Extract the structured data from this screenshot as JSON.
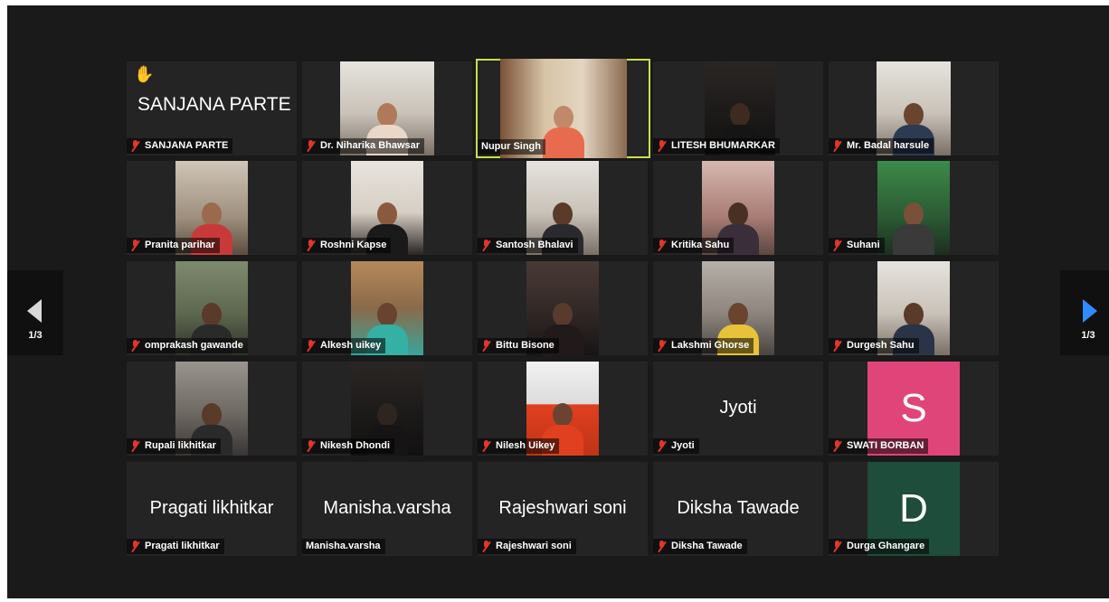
{
  "pager_left": {
    "label": "1/3",
    "icon": "chevron-left-icon"
  },
  "pager_right": {
    "label": "1/3",
    "icon": "chevron-right-icon",
    "color": "#2d8cff"
  },
  "active_speaker_border": "#c8e04a",
  "muted_icon": "mic-muted-icon",
  "participants": [
    {
      "name": "SANJANA PARTE",
      "display_name": "SANJANA PARTE",
      "hand_raised": true,
      "muted": true,
      "video": false
    },
    {
      "name": "Dr. Niharika Bhawsar",
      "muted": true,
      "video": true
    },
    {
      "name": "Nupur Singh",
      "muted": false,
      "video": true,
      "active_speaker": true
    },
    {
      "name": "LITESH BHUMARKAR",
      "muted": true,
      "video": true
    },
    {
      "name": "Mr. Badal harsule",
      "muted": true,
      "video": true
    },
    {
      "name": "Pranita parihar",
      "muted": true,
      "video": true
    },
    {
      "name": "Roshni Kapse",
      "muted": true,
      "video": true
    },
    {
      "name": "Santosh Bhalavi",
      "muted": true,
      "video": true
    },
    {
      "name": "Kritika Sahu",
      "muted": true,
      "video": true
    },
    {
      "name": "Suhani",
      "muted": true,
      "video": true
    },
    {
      "name": "omprakash gawande",
      "muted": true,
      "video": true
    },
    {
      "name": "Alkesh uikey",
      "muted": true,
      "video": true
    },
    {
      "name": "Bittu Bisone",
      "muted": true,
      "video": true
    },
    {
      "name": "Lakshmi Ghorse",
      "muted": true,
      "video": true
    },
    {
      "name": "Durgesh Sahu",
      "muted": true,
      "video": true
    },
    {
      "name": "Rupali likhitkar",
      "muted": true,
      "video": true
    },
    {
      "name": "Nikesh Dhondi",
      "muted": true,
      "video": true
    },
    {
      "name": "Nilesh Uikey",
      "muted": true,
      "video": true
    },
    {
      "name": "Jyoti",
      "display_name": "Jyoti",
      "muted": true,
      "video": false
    },
    {
      "name": "SWATI BORBAN",
      "avatar_letter": "S",
      "avatar_color": "#e0457a",
      "muted": true,
      "video": false
    },
    {
      "name": "Pragati likhitkar",
      "display_name": "Pragati likhitkar",
      "muted": true,
      "video": false
    },
    {
      "name": "Manisha.varsha",
      "display_name": "Manisha.varsha",
      "muted": false,
      "video": false
    },
    {
      "name": "Rajeshwari soni",
      "display_name": "Rajeshwari soni",
      "muted": true,
      "video": false
    },
    {
      "name": "Diksha Tawade",
      "display_name": "Diksha Tawade",
      "muted": true,
      "video": false
    },
    {
      "name": "Durga Ghangare",
      "avatar_letter": "D",
      "avatar_color": "#1f4d3b",
      "muted": true,
      "video": false
    }
  ]
}
